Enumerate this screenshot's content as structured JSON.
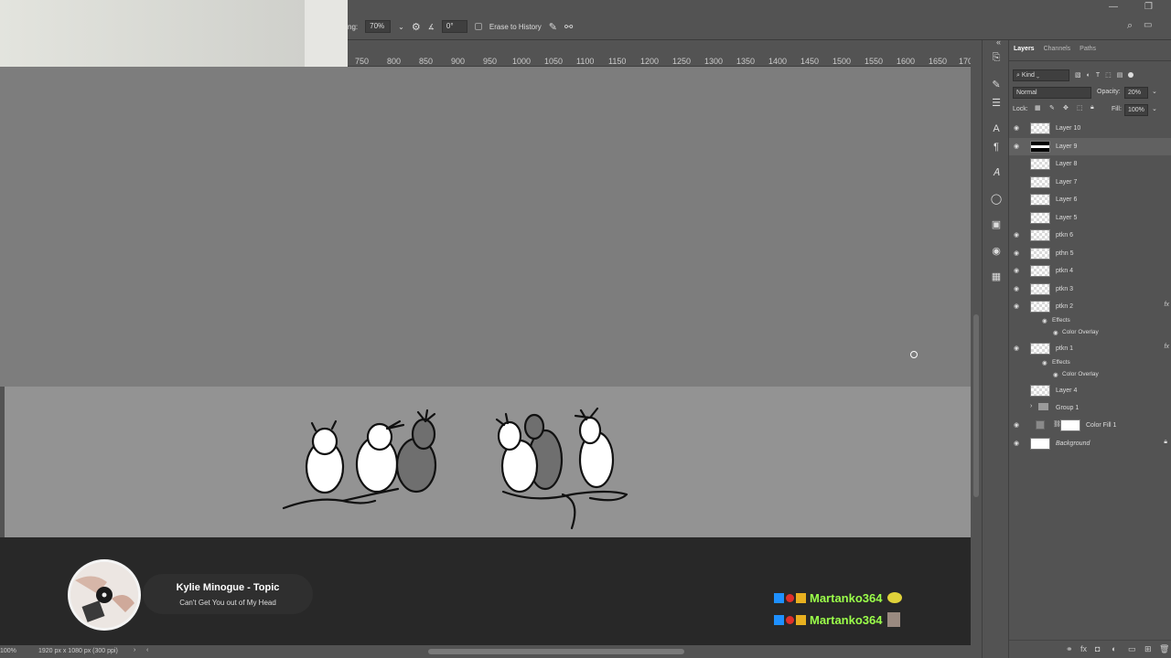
{
  "options_bar": {
    "opacity_prefix": "ng:",
    "opacity_value": "70%",
    "angle_value": "0°",
    "erase_to_history_label": "Erase to History"
  },
  "ruler": {
    "ticks": [
      "750",
      "800",
      "850",
      "900",
      "950",
      "1000",
      "1050",
      "1100",
      "1150",
      "1200",
      "1250",
      "1300",
      "1350",
      "1400",
      "1450",
      "1500",
      "1550",
      "1600",
      "1650",
      "170"
    ]
  },
  "status_bar": {
    "zoom": "100%",
    "doc_info": "1920 px x 1080 px (300 ppi)"
  },
  "music": {
    "artist": "Kylie Minogue - Topic",
    "song": "Can't Get You out of My Head"
  },
  "chat": {
    "entries": [
      {
        "name": "Martanko364"
      },
      {
        "name": "Martanko364"
      }
    ]
  },
  "panel": {
    "tabs": [
      "Layers",
      "Channels",
      "Paths"
    ],
    "filter_kind": "Kind",
    "blend_mode": "Normal",
    "opacity_label": "Opacity:",
    "opacity_value": "20%",
    "lock_label": "Lock:",
    "fill_label": "Fill:",
    "fill_value": "100%"
  },
  "layers": [
    {
      "name": "Layer 10",
      "visible": true
    },
    {
      "name": "Layer 9",
      "visible": true
    },
    {
      "name": "Layer 8",
      "visible": false
    },
    {
      "name": "Layer 7",
      "visible": false
    },
    {
      "name": "Layer 6",
      "visible": false
    },
    {
      "name": "Layer 5",
      "visible": false
    },
    {
      "name": "ptkn 6",
      "visible": true
    },
    {
      "name": "pthn 5",
      "visible": true
    },
    {
      "name": "ptkn 4",
      "visible": true
    },
    {
      "name": "ptkn 3",
      "visible": true
    },
    {
      "name": "ptkn 2",
      "visible": true,
      "fx": "fx"
    },
    {
      "name": "ptkn 1",
      "visible": true,
      "fx": "fx"
    },
    {
      "name": "Layer 4",
      "visible": false
    },
    {
      "name": "Group 1",
      "visible": false
    },
    {
      "name": "Color Fill 1",
      "visible": true
    },
    {
      "name": "Background",
      "visible": true
    }
  ],
  "effects": {
    "effects_label": "Effects",
    "color_overlay_label": "Color Overlay"
  }
}
